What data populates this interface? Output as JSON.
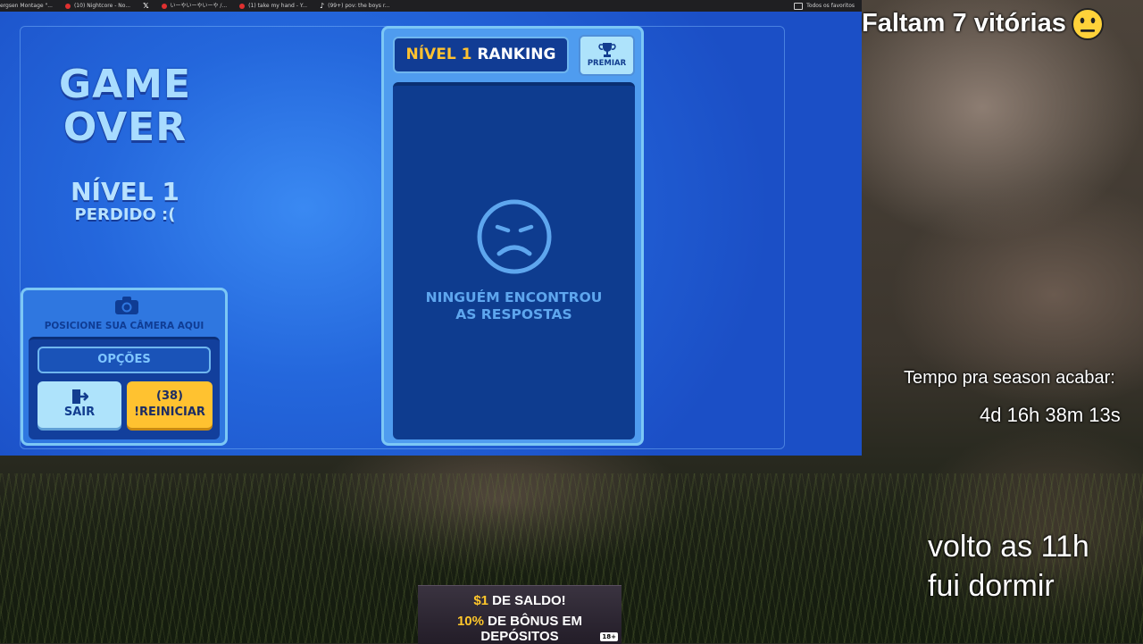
{
  "browser": {
    "bookmarks": [
      "ergsen Montage \"...",
      "(10) Nightcore - No...",
      "",
      "いーやいーやいーや /...",
      "(1) take my hand - Y...",
      "(99+) pov: the boys r..."
    ],
    "all_favorites": "Todos os favoritos"
  },
  "game": {
    "title_line1": "GAME",
    "title_line2": "OVER",
    "level": "NÍVEL 1",
    "lost": "PERDIDO :(",
    "camera_label": "POSICIONE SUA CÂMERA AQUI",
    "options_button": "OPÇÕES",
    "exit_button": "SAIR",
    "restart_count": "(38)",
    "restart_button": "!REINICIAR",
    "ranking_level": "NÍVEL 1",
    "ranking_word": "RANKING",
    "prize_button": "PREMIAR",
    "empty_message_line1": "NINGUÉM ENCONTROU",
    "empty_message_line2": "AS RESPOSTAS"
  },
  "overlay": {
    "wins_remaining": "Faltam 7 vitórias",
    "season_label": "Tempo pra season acabar:",
    "season_time": "4d 16h 38m 13s",
    "note_line1": "volto as 11h",
    "note_line2": "fui dormir"
  },
  "ad": {
    "line1_highlight": "$1",
    "line1_rest": " DE SALDO!",
    "line2_highlight": "10%",
    "line2_rest": " DE BÔNUS EM DEPÓSITOS",
    "age": "18+"
  },
  "colors": {
    "game_blue": "#2467dc",
    "accent_yellow": "#ffc230",
    "light_blue": "#aee3fb",
    "dark_navy": "#0e3c8f"
  }
}
